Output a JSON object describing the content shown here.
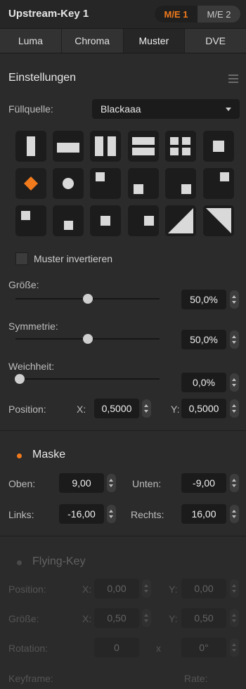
{
  "header": {
    "title": "Upstream-Key 1",
    "me_tabs": [
      "M/E 1",
      "M/E 2"
    ],
    "me_active": 0
  },
  "tabs": [
    "Luma",
    "Chroma",
    "Muster",
    "DVE"
  ],
  "tab_active": 2,
  "settings": {
    "title": "Einstellungen",
    "fill_source_label": "Füllquelle:",
    "fill_source_value": "Blackaaa",
    "invert_label": "Muster invertieren",
    "invert_checked": false,
    "size_label": "Größe:",
    "size_value": "50,0%",
    "size_fraction": 0.5,
    "symmetry_label": "Symmetrie:",
    "symmetry_value": "50,0%",
    "symmetry_fraction": 0.5,
    "softness_label": "Weichheit:",
    "softness_value": "0,0%",
    "softness_fraction": 0.0,
    "position_label": "Position:",
    "x_label": "X:",
    "x_value": "0,5000",
    "y_label": "Y:",
    "y_value": "0,5000",
    "patterns": [
      "pattern-vertical-bar",
      "pattern-horizontal-bar",
      "pattern-vertical-barn-door",
      "pattern-horizontal-barn-door",
      "pattern-corners-in",
      "pattern-box-iris",
      "pattern-diamond-iris",
      "pattern-circle-iris",
      "pattern-top-left-box",
      "pattern-bottom-left-box",
      "pattern-bottom-right-box",
      "pattern-top-right-box",
      "pattern-top-left-box-2",
      "pattern-bottom-center-box",
      "pattern-center-box",
      "pattern-right-center-box",
      "pattern-diagonal-bottom-right",
      "pattern-diagonal-top-right"
    ],
    "active_pattern": 6,
    "accent_color": "#f07a1c"
  },
  "mask": {
    "title": "Maske",
    "enabled": true,
    "top_label": "Oben:",
    "top_value": "9,00",
    "bottom_label": "Unten:",
    "bottom_value": "-9,00",
    "left_label": "Links:",
    "left_value": "-16,00",
    "right_label": "Rechts:",
    "right_value": "16,00"
  },
  "flying_key": {
    "title": "Flying-Key",
    "enabled": false,
    "position_label": "Position:",
    "pos_x_label": "X:",
    "pos_x_value": "0,00",
    "pos_y_label": "Y:",
    "pos_y_value": "0,00",
    "size_label": "Größe:",
    "size_x_label": "X:",
    "size_x_value": "0,50",
    "size_y_label": "Y:",
    "size_y_value": "0,50",
    "rotation_label": "Rotation:",
    "rotation_value": "0",
    "rotation_x": "x",
    "rotation_deg_value": "0°",
    "keyframe_label": "Keyframe:",
    "rate_label": "Rate:"
  }
}
